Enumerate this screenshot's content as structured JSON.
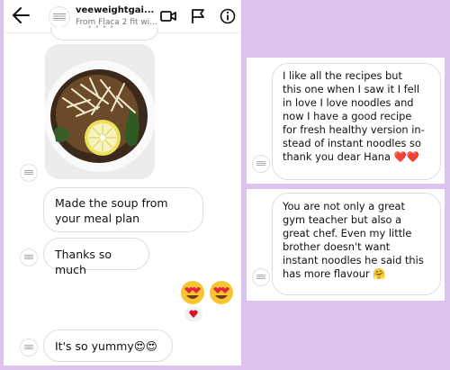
{
  "chat": {
    "header": {
      "username": "veeweightgai...",
      "subtitle": "From Flaca 2 fit wi...",
      "icons": [
        "back-arrow-icon",
        "video-camera-icon",
        "flag-icon",
        "info-icon"
      ]
    },
    "messages": [
      {
        "id": "m1",
        "text": "Made the soup from your meal plan"
      },
      {
        "id": "m2",
        "text": "Thanks so much"
      },
      {
        "id": "m3",
        "text": "It's so yummy😍😍"
      }
    ],
    "sent_emoji": "😍😍",
    "reaction": "heart"
  },
  "cards": [
    {
      "lines": [
        "I like all the recipes but",
        "this one when I saw it I fell",
        "in love I love noodles and",
        "now I have a good recipe",
        "for fresh healthy version in-",
        "stead of instant noodles so",
        "thank you dear Hana ❤️❤️"
      ]
    },
    {
      "lines": [
        "You are not only a great",
        "gym teacher but also a",
        "great chef. Even my little",
        "brother doesn't want",
        "instant noodles he said this",
        "has more flavour 🤗"
      ]
    }
  ],
  "colors": {
    "background": "#dcc2ee",
    "heart": "#d6132b",
    "emoji_face": "#f7c531"
  }
}
